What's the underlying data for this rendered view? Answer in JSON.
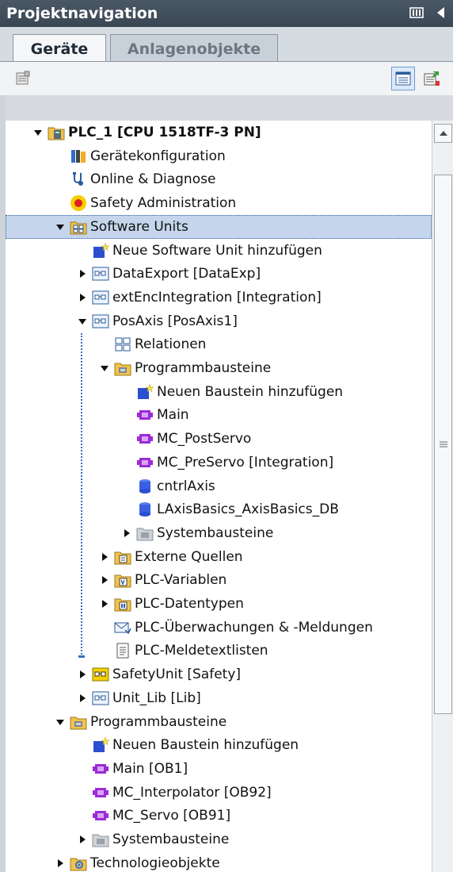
{
  "panel": {
    "title": "Projektnavigation",
    "title_icons": [
      "panel-layout-icon",
      "collapse-left-icon"
    ]
  },
  "tabs": [
    {
      "label": "Geräte",
      "active": true
    },
    {
      "label": "Anlagenobjekte",
      "active": false
    }
  ],
  "toolbar": {
    "left_icons": [
      "device-view-icon"
    ],
    "right_icons": [
      "details-view-icon",
      "export-icon"
    ]
  },
  "tree": [
    {
      "label": "PLC_1 [CPU 1518TF-3 PN]",
      "expander": "expanded",
      "icon": "plc-folder-icon",
      "bold": true
    },
    {
      "label": "Gerätekonfiguration",
      "expander": "none",
      "icon": "device-config-icon"
    },
    {
      "label": "Online & Diagnose",
      "expander": "none",
      "icon": "online-diagnostics-icon"
    },
    {
      "label": "Safety Administration",
      "expander": "none",
      "icon": "safety-admin-icon"
    },
    {
      "label": "Software Units",
      "expander": "expanded",
      "icon": "software-units-icon",
      "selected": true
    },
    {
      "label": "Neue Software Unit hinzufügen",
      "expander": "none",
      "icon": "add-new-icon"
    },
    {
      "label": "DataExport [DataExp]",
      "expander": "collapsed",
      "icon": "software-unit-icon"
    },
    {
      "label": "extEncIntegration [Integration]",
      "expander": "collapsed",
      "icon": "software-unit-icon"
    },
    {
      "label": "PosAxis [PosAxis1]",
      "expander": "expanded",
      "icon": "software-unit-icon"
    },
    {
      "label": "Relationen",
      "expander": "none",
      "icon": "relations-icon"
    },
    {
      "label": "Programmbausteine",
      "expander": "expanded",
      "icon": "program-blocks-folder-icon"
    },
    {
      "label": "Neuen Baustein hinzufügen",
      "expander": "none",
      "icon": "add-new-icon"
    },
    {
      "label": "Main",
      "expander": "none",
      "icon": "ob-block-icon"
    },
    {
      "label": "MC_PostServo",
      "expander": "none",
      "icon": "ob-block-icon"
    },
    {
      "label": "MC_PreServo [Integration]",
      "expander": "none",
      "icon": "ob-block-icon"
    },
    {
      "label": "cntrlAxis",
      "expander": "none",
      "icon": "db-block-icon"
    },
    {
      "label": "LAxisBasics_AxisBasics_DB",
      "expander": "none",
      "icon": "db-block-icon"
    },
    {
      "label": "Systembausteine",
      "expander": "collapsed",
      "icon": "system-blocks-icon"
    },
    {
      "label": "Externe Quellen",
      "expander": "collapsed",
      "icon": "external-sources-icon"
    },
    {
      "label": "PLC-Variablen",
      "expander": "collapsed",
      "icon": "plc-tags-icon"
    },
    {
      "label": "PLC-Datentypen",
      "expander": "collapsed",
      "icon": "plc-datatypes-icon"
    },
    {
      "label": "PLC-Überwachungen & -Meldungen",
      "expander": "none",
      "icon": "plc-alarms-icon"
    },
    {
      "label": "PLC-Meldetextlisten",
      "expander": "none",
      "icon": "text-lists-icon"
    },
    {
      "label": "SafetyUnit [Safety]",
      "expander": "collapsed",
      "icon": "safety-unit-icon"
    },
    {
      "label": "Unit_Lib [Lib]",
      "expander": "collapsed",
      "icon": "software-unit-icon"
    },
    {
      "label": "Programmbausteine",
      "expander": "expanded",
      "icon": "program-blocks-folder-icon"
    },
    {
      "label": "Neuen Baustein hinzufügen",
      "expander": "none",
      "icon": "add-new-icon"
    },
    {
      "label": "Main [OB1]",
      "expander": "none",
      "icon": "ob-block-icon"
    },
    {
      "label": "MC_Interpolator [OB92]",
      "expander": "none",
      "icon": "ob-block-icon"
    },
    {
      "label": "MC_Servo [OB91]",
      "expander": "none",
      "icon": "ob-block-icon"
    },
    {
      "label": "Systembausteine",
      "expander": "collapsed",
      "icon": "system-blocks-icon"
    },
    {
      "label": "Technologieobjekte",
      "expander": "collapsed",
      "icon": "technology-objects-icon"
    }
  ],
  "scrollbar": {
    "icons": [
      "scroll-up-icon",
      "scroll-grip-icon"
    ]
  }
}
